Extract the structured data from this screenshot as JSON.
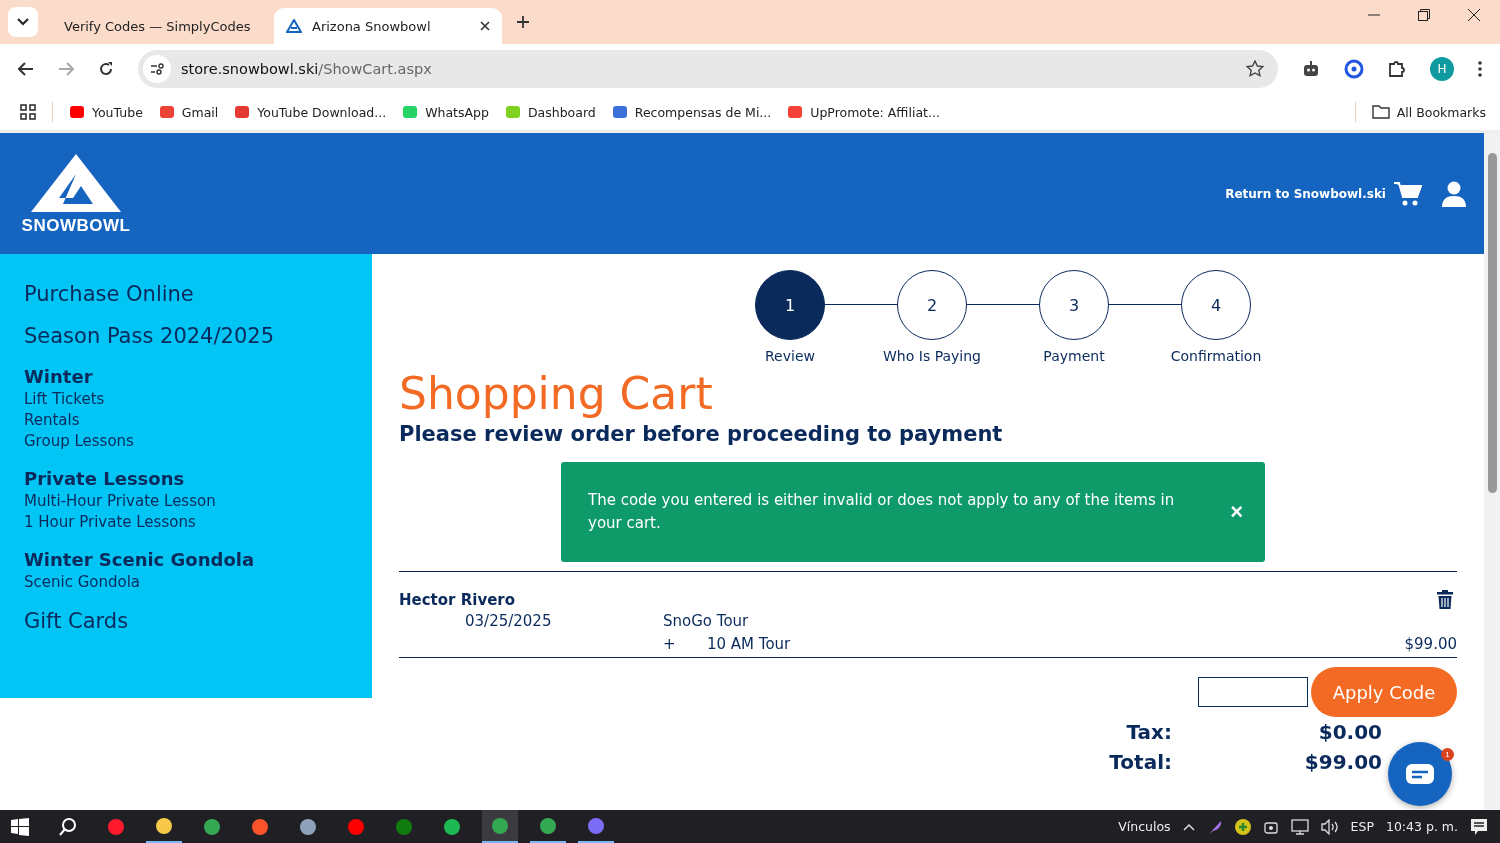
{
  "browser": {
    "tabs": [
      {
        "title": "Verify Codes — SimplyCodes",
        "kind": "simplycodes",
        "selected": false
      },
      {
        "title": "Arizona Snowbowl",
        "kind": "snowbowl",
        "selected": true
      }
    ],
    "url_host": "store.snowbowl.ski",
    "url_path": "/ShowCart.aspx",
    "profile_initial": "H",
    "bookmarks": [
      {
        "label": "YouTube",
        "kind": "youtube"
      },
      {
        "label": "Gmail",
        "kind": "gmail"
      },
      {
        "label": "YouTube Download...",
        "kind": "download"
      },
      {
        "label": "WhatsApp",
        "kind": "whatsapp"
      },
      {
        "label": "Dashboard",
        "kind": "simplycodes"
      },
      {
        "label": "Recompensas de Mi...",
        "kind": "medal"
      },
      {
        "label": "UpPromote: Affiliat...",
        "kind": "uppromote"
      }
    ],
    "all_bookmarks": "All Bookmarks"
  },
  "header": {
    "logo_text": "SNOWBOWL",
    "return_link": "Return to Snowbowl.ski"
  },
  "sidebar": [
    {
      "kind": "title",
      "label": "Purchase Online"
    },
    {
      "kind": "title",
      "label": "Season Pass 2024/2025"
    },
    {
      "kind": "section",
      "label": "Winter",
      "items": [
        "Lift Tickets",
        "Rentals",
        "Group Lessons"
      ]
    },
    {
      "kind": "section",
      "label": "Private Lessons",
      "items": [
        "Multi-Hour Private Lesson",
        "1 Hour Private Lessons"
      ]
    },
    {
      "kind": "section",
      "label": "Winter Scenic Gondola",
      "items": [
        "Scenic Gondola"
      ]
    },
    {
      "kind": "title",
      "label": "Gift Cards"
    }
  ],
  "steps": [
    {
      "number": "1",
      "label": "Review",
      "selected": true
    },
    {
      "number": "2",
      "label": "Who Is Paying",
      "selected": false
    },
    {
      "number": "3",
      "label": "Payment",
      "selected": false
    },
    {
      "number": "4",
      "label": "Confirmation",
      "selected": false
    }
  ],
  "title": "Shopping Cart",
  "subtitle": "Please review order before proceeding to payment",
  "alert": {
    "message": "The code you entered is either invalid or does not apply to any of the items in your cart.",
    "close": "×"
  },
  "cart": {
    "guest": "Hector Rivero",
    "date": "03/25/2025",
    "product": "SnoGo Tour",
    "option_mark": "+",
    "option": "10 AM Tour",
    "price": "$99.00"
  },
  "apply_button": "Apply Code",
  "totals": [
    {
      "label": "Tax:",
      "value": "$0.00"
    },
    {
      "label": "Total:",
      "value": "$99.00"
    }
  ],
  "chat_badge": "1",
  "taskbar": {
    "apps": [
      {
        "kind": "windows",
        "open": false,
        "selected": false
      },
      {
        "kind": "search",
        "open": false,
        "selected": false
      },
      {
        "kind": "opera",
        "open": false,
        "selected": false
      },
      {
        "kind": "folder",
        "open": true,
        "selected": false
      },
      {
        "kind": "chrome",
        "open": false,
        "selected": false
      },
      {
        "kind": "brave",
        "open": false,
        "selected": false
      },
      {
        "kind": "calculator",
        "open": false,
        "selected": false
      },
      {
        "kind": "youtube",
        "open": false,
        "selected": false
      },
      {
        "kind": "xbox",
        "open": false,
        "selected": false
      },
      {
        "kind": "spotify",
        "open": false,
        "selected": false
      },
      {
        "kind": "chrome",
        "open": true,
        "selected": true
      },
      {
        "kind": "chrome",
        "open": true,
        "selected": false
      },
      {
        "kind": "vpn",
        "open": true,
        "selected": false
      }
    ],
    "tray_label": "Vínculos",
    "language": "ESP",
    "time": "10:43 p. m."
  }
}
